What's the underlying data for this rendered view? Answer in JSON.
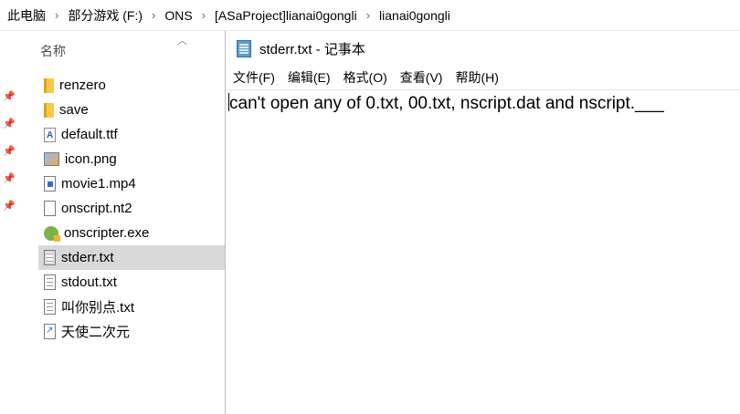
{
  "explorer": {
    "breadcrumbs": [
      "此电脑",
      "部分游戏 (F:)",
      "ONS",
      "[ASaProject]lianai0gongli",
      "lianai0gongli"
    ],
    "column_header": "名称",
    "files": [
      {
        "name": "renzero",
        "icon": "folder-icon"
      },
      {
        "name": "save",
        "icon": "folder-icon"
      },
      {
        "name": "default.ttf",
        "icon": "font-file-icon"
      },
      {
        "name": "icon.png",
        "icon": "image-file-icon"
      },
      {
        "name": "movie1.mp4",
        "icon": "video-file-icon"
      },
      {
        "name": "onscript.nt2",
        "icon": "blank-file-icon"
      },
      {
        "name": "onscripter.exe",
        "icon": "exe-file-icon"
      },
      {
        "name": "stderr.txt",
        "icon": "text-file-icon",
        "selected": true
      },
      {
        "name": "stdout.txt",
        "icon": "text-file-icon"
      },
      {
        "name": "叫你别点.txt",
        "icon": "text-file-icon"
      },
      {
        "name": "天使二次元",
        "icon": "shortcut-icon"
      }
    ]
  },
  "notepad": {
    "title": "stderr.txt - 记事本",
    "menu": [
      "文件(F)",
      "编辑(E)",
      "格式(O)",
      "查看(V)",
      "帮助(H)"
    ],
    "content": "can't open any of 0.txt, 00.txt, nscript.dat and nscript.___"
  }
}
